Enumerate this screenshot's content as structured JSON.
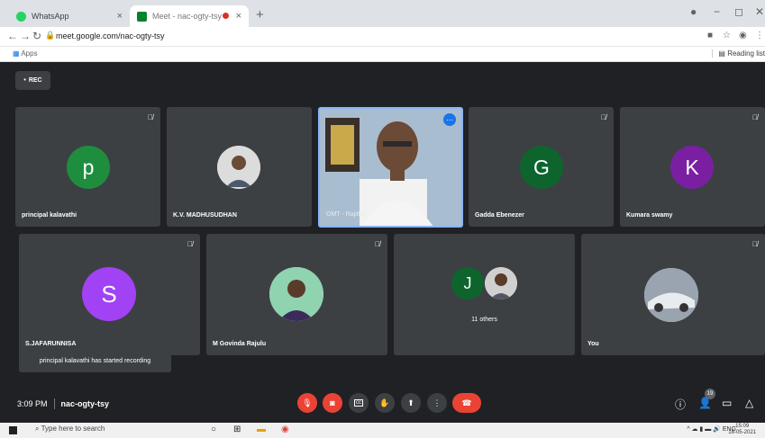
{
  "browser": {
    "tabs": [
      {
        "title": "WhatsApp",
        "close": "×"
      },
      {
        "title": "Meet - nac-ogty-tsy",
        "close": "×"
      }
    ],
    "new_tab": "+",
    "url": "meet.google.com/nac-ogty-tsy",
    "apps_label": "Apps",
    "reading_list_label": "Reading list"
  },
  "meet": {
    "rec_label": "REC",
    "participants": [
      {
        "name": "principal kalavathi",
        "initial": "p",
        "color": "#1e8e3e"
      },
      {
        "name": "K.V. MADHUSUDHAN"
      },
      {
        "name": "OMT - Rajitha"
      },
      {
        "name": "Gadda Ebenezer",
        "initial": "G",
        "color": "#0d652d"
      },
      {
        "name": "Kumara swamy",
        "initial": "K",
        "color": "#7b1fa2"
      },
      {
        "name": "S.JAFARUNNISA",
        "initial": "S",
        "color": "#a142f4"
      },
      {
        "name": "M Govinda Rajulu"
      },
      {
        "name": "11 others",
        "initial": "J",
        "color": "#0d652d"
      },
      {
        "name": "You"
      }
    ],
    "toast": "principal kalavathi has started recording",
    "time": "3:09 PM",
    "meeting_code": "nac-ogty-tsy",
    "people_count": "19"
  },
  "taskbar": {
    "search_placeholder": "Type here to search",
    "tray_lang": "ENG",
    "clock_time": "15:09",
    "clock_date": "18-05-2021"
  },
  "colors": {
    "background": "#202124",
    "tile": "#3c4043",
    "hangup": "#ea4335",
    "active_speaker_border": "#8ab4f8"
  }
}
